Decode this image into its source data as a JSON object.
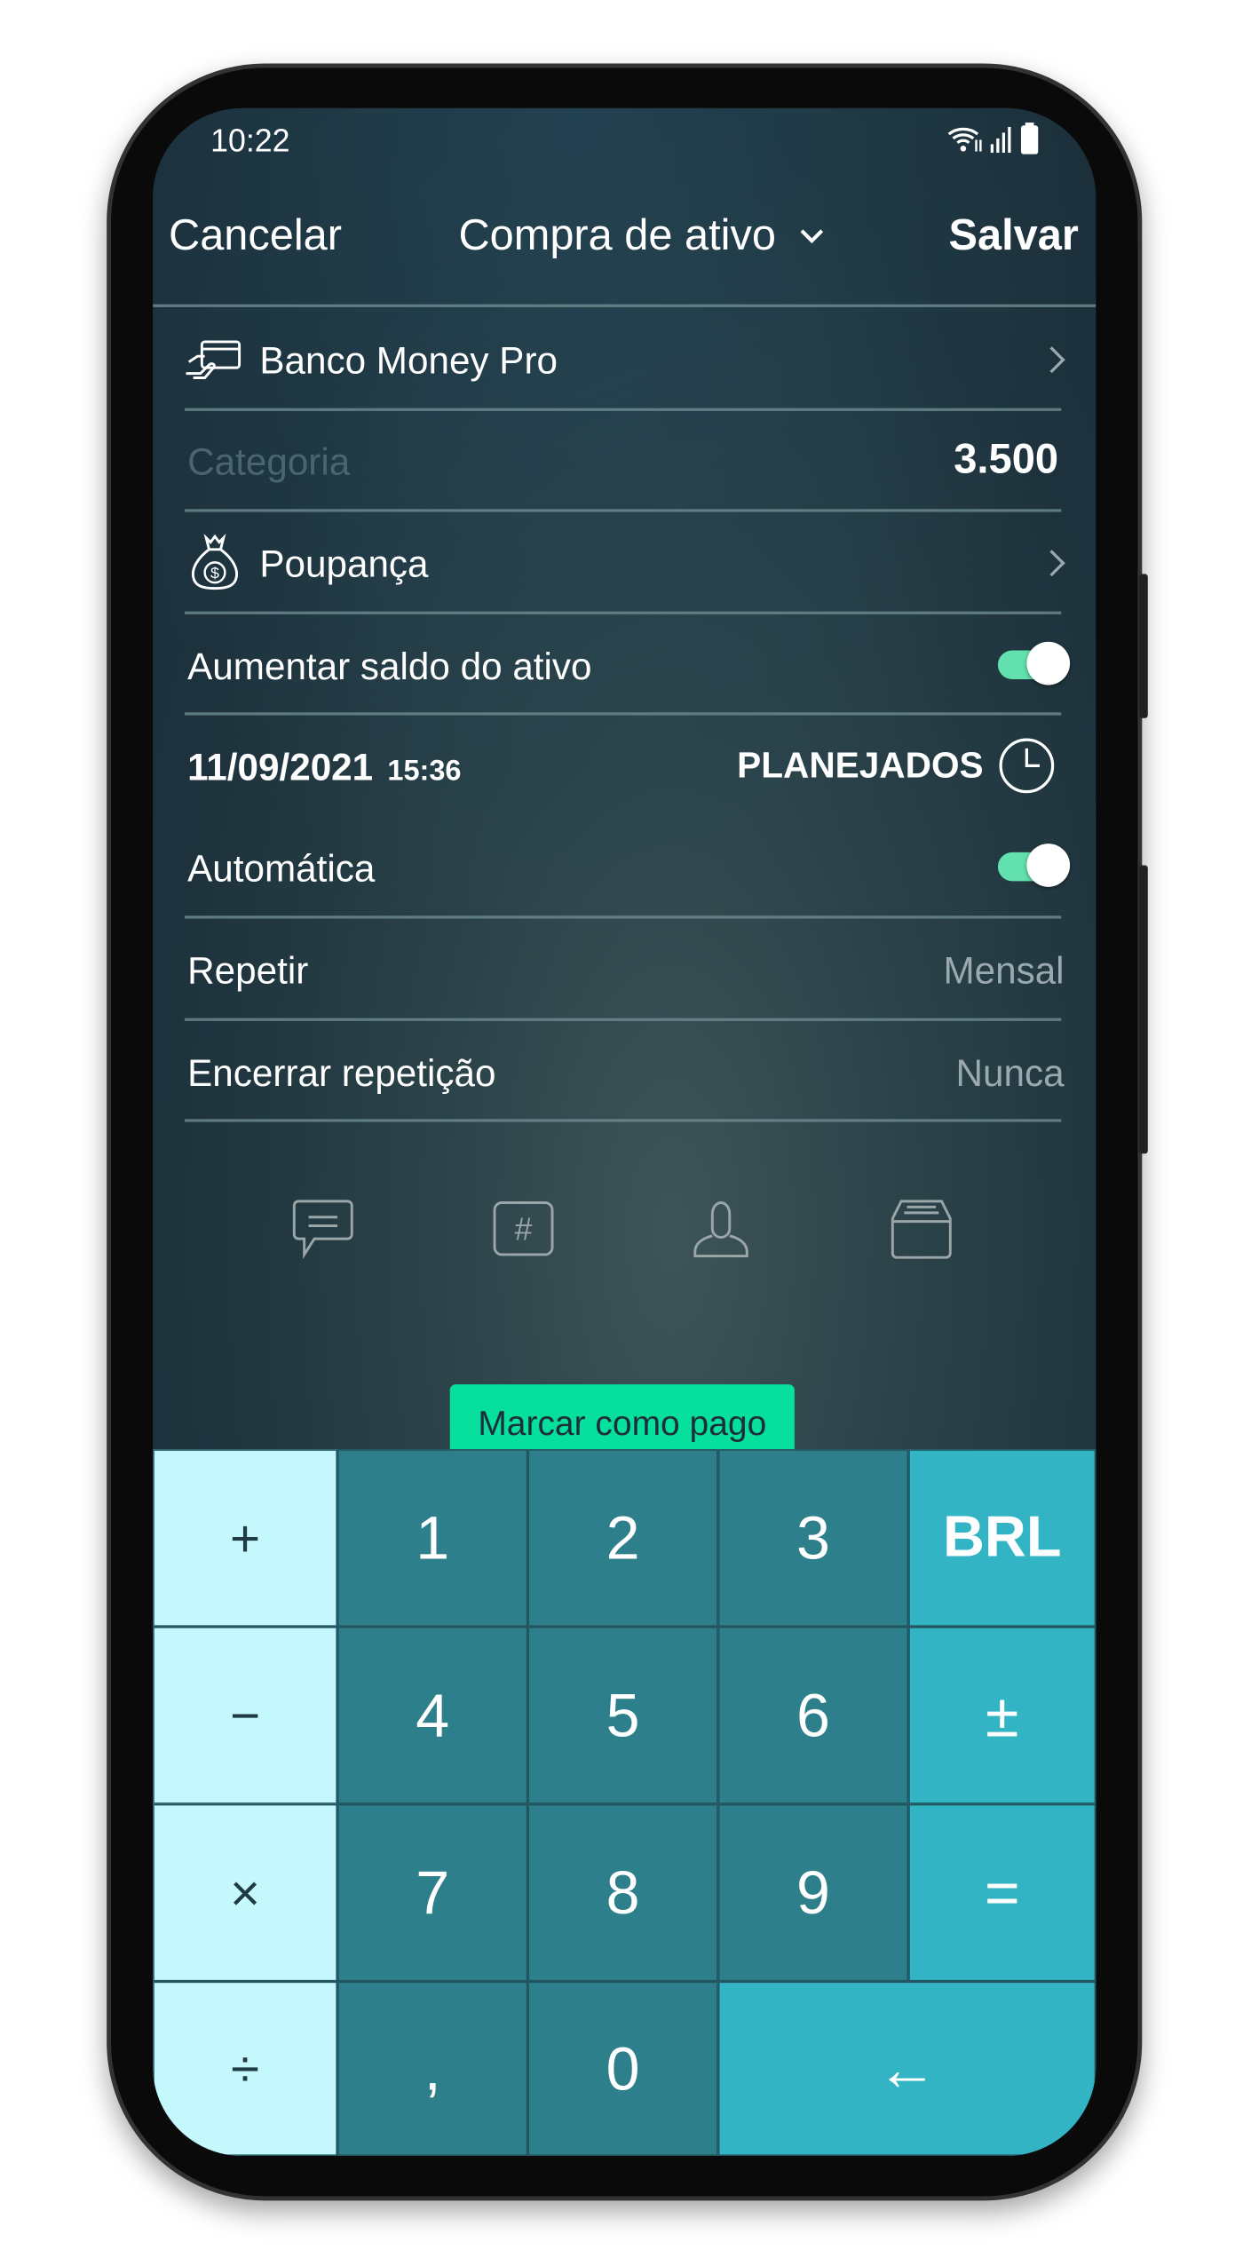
{
  "status_bar": {
    "time": "10:22",
    "icons": [
      "wifi-icon",
      "signal-icon",
      "battery-icon"
    ]
  },
  "header": {
    "cancel_label": "Cancelar",
    "title": "Compra de ativo",
    "save_label": "Salvar"
  },
  "form": {
    "account": {
      "label": "Banco Money Pro",
      "icon": "card-hand-icon"
    },
    "category": {
      "placeholder": "Categoria",
      "amount": "3.500"
    },
    "asset": {
      "label": "Poupança",
      "icon": "money-bag-icon"
    },
    "increase_balance": {
      "label": "Aumentar saldo do ativo",
      "on": true
    },
    "date": "11/09/2021",
    "time": "15:36",
    "planned_label": "PLANEJADOS",
    "automatic": {
      "label": "Automática",
      "on": true
    },
    "repeat": {
      "label": "Repetir",
      "value": "Mensal"
    },
    "end_repeat": {
      "label": "Encerrar repetição",
      "value": "Nunca"
    }
  },
  "toolbar_icons": [
    "comment-icon",
    "hashtag-icon",
    "person-icon",
    "inbox-icon"
  ],
  "mark_paid_label": "Marcar como pago",
  "keypad": {
    "keys": [
      "+",
      "1",
      "2",
      "3",
      "BRL",
      "−",
      "4",
      "5",
      "6",
      "±",
      "×",
      "7",
      "8",
      "9",
      "=",
      "÷",
      ",",
      "0",
      "←"
    ]
  },
  "colors": {
    "accent_green": "#06e09c",
    "key_operator": "#c4f8fc",
    "key_digit": "#2d7f8b",
    "key_function": "#32b4c4",
    "toggle_on": "#62e0ae"
  }
}
